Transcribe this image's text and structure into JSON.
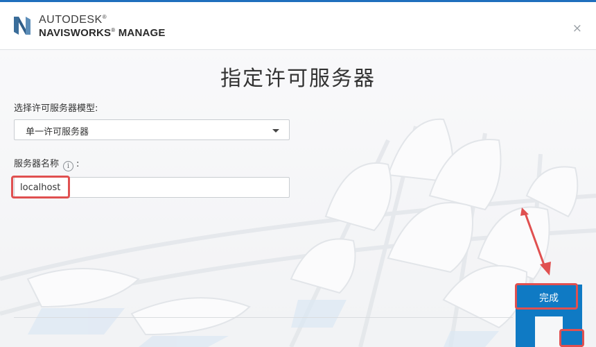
{
  "header": {
    "brand_top": "AUTODESK",
    "brand_product": "NAVISWORKS",
    "brand_edition": "MANAGE",
    "close_glyph": "×",
    "logo_icon": "autodesk-n-logo-icon",
    "accent_color": "#1f6fbd"
  },
  "dialog": {
    "title": "指定许可服务器",
    "model_label": "选择许可服务器模型:",
    "model_selected": "单一许可服务器",
    "server_label": "服务器名称",
    "server_label_suffix": ":",
    "info_glyph": "i",
    "server_value": "localhost"
  },
  "footer": {
    "finish_label": "完成",
    "button_color": "#0f7ac4"
  },
  "annotations": {
    "highlight_color": "#e05050"
  }
}
